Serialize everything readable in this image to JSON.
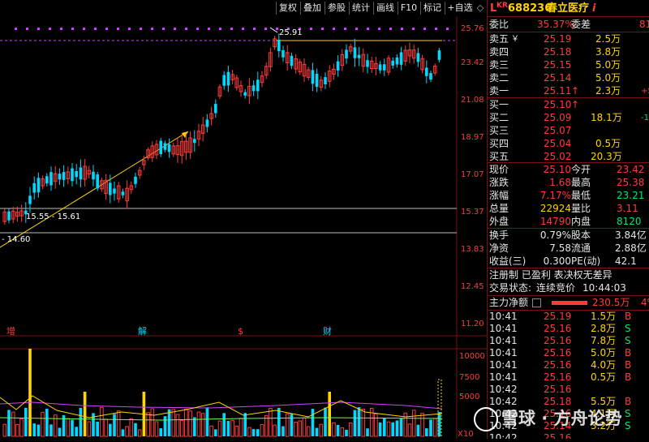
{
  "toolbar": {
    "buttons": [
      "复权",
      "叠加",
      "参股",
      "统计",
      "画线",
      "F10",
      "标记",
      "+自选"
    ]
  },
  "chart_labels": {
    "high_label": "25.91",
    "range_label": "15.55 - 15.61",
    "low_label": "14.60",
    "price_ticks": [
      "25.76",
      "23.42",
      "21.08",
      "18.97",
      "17.07",
      "15.37",
      "13.83",
      "12.45",
      "11.20"
    ],
    "volume_ticks": [
      "10000",
      "7500",
      "5000"
    ],
    "volume_unit": "X10",
    "event_markers": [
      "增",
      "解",
      "$",
      "财"
    ]
  },
  "quote": {
    "market_tag": "L",
    "market_sup": "KR",
    "code": "688236",
    "name": "春立医疗",
    "info_icon": "i",
    "wei_bi_label": "委比",
    "wei_bi": "35.37%",
    "wei_cha_label": "委差",
    "wei_cha": "81",
    "asks": [
      {
        "label": "卖五",
        "extra": "￥",
        "price": "25.19",
        "vol": "2.5万"
      },
      {
        "label": "卖四",
        "extra": "",
        "price": "25.18",
        "vol": "3.8万"
      },
      {
        "label": "卖三",
        "extra": "",
        "price": "25.15",
        "vol": "5.0万"
      },
      {
        "label": "卖二",
        "extra": "",
        "price": "25.14",
        "vol": "5.0万"
      },
      {
        "label": "卖一",
        "extra": "",
        "price": "25.11",
        "arrow": "↑",
        "vol": "2.3万",
        "chg": "+5"
      }
    ],
    "bids": [
      {
        "label": "买一",
        "price": "25.10",
        "arrow": "↑",
        "vol": "",
        "chg": ""
      },
      {
        "label": "买二",
        "price": "25.09",
        "arrow": "",
        "vol": "18.1万",
        "chg": "-1"
      },
      {
        "label": "买三",
        "price": "25.07",
        "arrow": "",
        "vol": "",
        "chg": ""
      },
      {
        "label": "买四",
        "price": "25.04",
        "arrow": "",
        "vol": "0.5万",
        "chg": ""
      },
      {
        "label": "买五",
        "price": "25.02",
        "arrow": "",
        "vol": "20.3万",
        "chg": ""
      }
    ],
    "stats": [
      {
        "l1": "现价",
        "v1": "25.10",
        "l2": "今开",
        "v2": "23.42",
        "c1": "red",
        "c2": "red"
      },
      {
        "l1": "涨跌",
        "v1": "1.68",
        "l2": "最高",
        "v2": "25.38",
        "c1": "red",
        "c2": "red"
      },
      {
        "l1": "涨幅",
        "v1": "7.17%",
        "l2": "最低",
        "v2": "23.21",
        "c1": "red",
        "c2": "grn"
      },
      {
        "l1": "总量",
        "v1": "22924",
        "l2": "量比",
        "v2": "3.11",
        "c1": "yel",
        "c2": "red"
      },
      {
        "l1": "外盘",
        "v1": "14790",
        "l2": "内盘",
        "v2": "8120",
        "c1": "red",
        "c2": "grn"
      }
    ],
    "stats2": [
      {
        "l1": "换手",
        "v1": "0.79%",
        "l2": "股本",
        "v2": "3.84亿"
      },
      {
        "l1": "净资",
        "v1": "7.58",
        "l2": "流通",
        "v2": "2.88亿"
      },
      {
        "l1": "收益(三)",
        "v1": "0.300",
        "l2": "PE(动)",
        "v2": "42.1"
      }
    ],
    "reg_text": "注册制 已盈利 表决权无差异",
    "trade_state_label": "交易状态:",
    "trade_state": "连续竞价",
    "trade_time": "10:44:03",
    "main_flow_label": "主力净额",
    "main_flow": "230.5万",
    "main_flow_pct": "4%",
    "ticks": [
      {
        "t": "10:41",
        "p": "25.19",
        "v": "1.5万",
        "d": "B"
      },
      {
        "t": "10:41",
        "p": "25.16",
        "v": "2.8万",
        "d": "S"
      },
      {
        "t": "10:41",
        "p": "25.16",
        "v": "7.8万",
        "d": "S"
      },
      {
        "t": "10:41",
        "p": "25.16",
        "v": "5.0万",
        "d": "B"
      },
      {
        "t": "10:41",
        "p": "25.16",
        "v": "4.0万",
        "d": "B"
      },
      {
        "t": "10:41",
        "p": "25.16",
        "v": "0.5万",
        "d": "B"
      },
      {
        "t": "10:42",
        "p": "25.16",
        "v": "",
        "d": ""
      },
      {
        "t": "10:42",
        "p": "25.18",
        "v": "5.5万",
        "d": "B"
      },
      {
        "t": "10:42",
        "p": "25.16",
        "v": "4.1万",
        "d": "S"
      },
      {
        "t": "10:42",
        "p": "25.14",
        "v": "3.2万",
        "d": "S"
      },
      {
        "t": "10:42",
        "p": "25.16",
        "v": "",
        "d": ""
      }
    ]
  },
  "watermark": "雪球 · 方舟论势",
  "colors": {
    "up": "#ff3b3b",
    "down": "#00d8ff",
    "yellow": "#ffd400",
    "purple": "#d040ff",
    "bg": "#000000"
  }
}
